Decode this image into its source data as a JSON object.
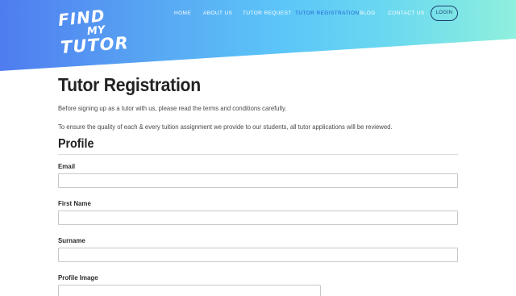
{
  "brand": {
    "logo_line1": "FIND",
    "logo_line2": "MY",
    "logo_line3": "TUTOR"
  },
  "nav": {
    "items": [
      {
        "label": "HOME"
      },
      {
        "label": "ABOUT US"
      },
      {
        "label": "TUTOR REQUEST"
      },
      {
        "label": "TUTOR REGISTRATION",
        "active": true
      },
      {
        "label": "BLOG"
      },
      {
        "label": "CONTACT US"
      }
    ],
    "login_label": "LOGIN"
  },
  "page": {
    "title": "Tutor Registration",
    "intro1": "Before signing up as a tutor with us, please read the terms and conditions carefully.",
    "intro2": "To ensure the quality of each & every tuition assignment we provide to our students, all tutor applications will be reviewed."
  },
  "profile": {
    "section_title": "Profile",
    "fields": [
      {
        "label": "Email",
        "value": "",
        "placeholder": ""
      },
      {
        "label": "First Name",
        "value": "",
        "placeholder": ""
      },
      {
        "label": "Surname",
        "value": "",
        "placeholder": ""
      },
      {
        "label": "Profile Image"
      }
    ]
  },
  "colors": {
    "accent": "#1f63d6",
    "gradient_start": "#4f7cf0",
    "gradient_end": "#8ff0dd",
    "nav_text": "#ffffff",
    "login_border": "#1c3d6e"
  }
}
